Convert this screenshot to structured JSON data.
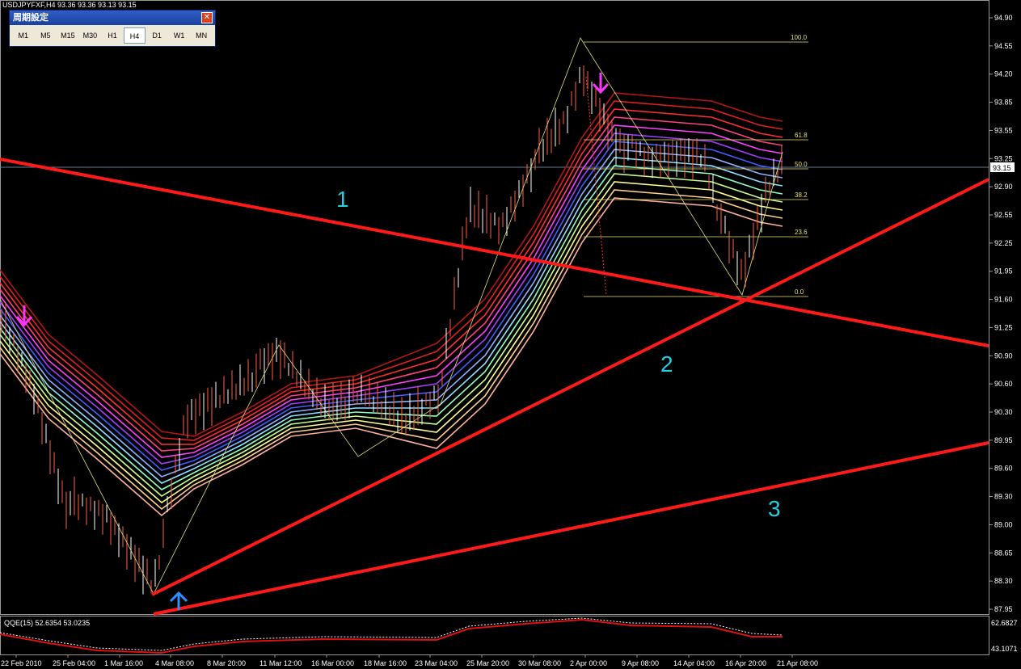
{
  "header": {
    "symbol_info": "USDJPYFXF,H4  93.36 93.36 93.13 93.15"
  },
  "timeframe_panel": {
    "title": "周期設定",
    "close_icon": "close-icon",
    "buttons": [
      "M1",
      "M5",
      "M15",
      "M30",
      "H1",
      "H4",
      "D1",
      "W1",
      "MN"
    ],
    "active": "H4"
  },
  "price_axis": {
    "labels": [
      "94.90",
      "94.55",
      "94.20",
      "93.85",
      "93.55",
      "93.25",
      "92.90",
      "92.55",
      "92.25",
      "91.95",
      "91.60",
      "91.25",
      "90.90",
      "90.60",
      "90.30",
      "89.95",
      "89.60",
      "89.30",
      "89.00",
      "88.65",
      "88.30",
      "87.95"
    ],
    "current_price": "93.15"
  },
  "time_axis": {
    "labels": [
      "22 Feb 2010",
      "25 Feb 04:00",
      "1 Mar 16:00",
      "4 Mar 08:00",
      "8 Mar 20:00",
      "11 Mar 12:00",
      "16 Mar 00:00",
      "18 Mar 16:00",
      "23 Mar 04:00",
      "25 Mar 20:00",
      "30 Mar 08:00",
      "2 Apr 00:00",
      "9 Apr 08:00",
      "14 Apr 04:00",
      "16 Apr 20:00",
      "21 Apr 08:00"
    ]
  },
  "fibonacci": {
    "levels": [
      "100.0",
      "61.8",
      "50.0",
      "38.2",
      "23.6",
      "0.0"
    ],
    "color": "#e8e07a"
  },
  "trendline_labels": [
    "1",
    "2",
    "3"
  ],
  "colors": {
    "trendline": "#ff1a1a",
    "label": "#22d0e0",
    "arrow_down": "#ff33ff",
    "arrow_up": "#2f8fff"
  },
  "subwindow": {
    "title": "QQE(15) 52.6354 53.0235",
    "max": "62.6827",
    "min": "43.1071"
  }
}
